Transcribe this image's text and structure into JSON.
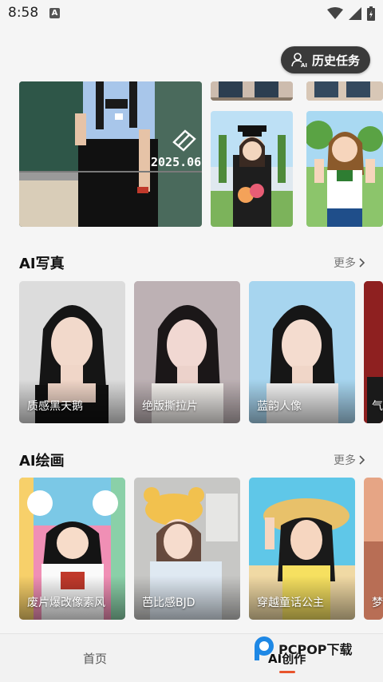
{
  "status_bar": {
    "time": "8:58",
    "notification_icon": "A"
  },
  "header": {
    "history_button_label": "历史任务"
  },
  "hero": {
    "badge_text": "2025.06"
  },
  "sections": [
    {
      "title": "AI写真",
      "more_label": "更多",
      "cards": [
        {
          "label": "质感黑天鹅"
        },
        {
          "label": "绝版撕拉片"
        },
        {
          "label": "蓝韵人像"
        },
        {
          "label": "气"
        }
      ]
    },
    {
      "title": "AI绘画",
      "more_label": "更多",
      "cards": [
        {
          "label": "废片爆改像素风"
        },
        {
          "label": "芭比感BJD"
        },
        {
          "label": "穿越童话公主"
        },
        {
          "label": "梦"
        }
      ]
    }
  ],
  "bottom_nav": {
    "tabs": [
      {
        "label": "首页"
      },
      {
        "label": "AI创作"
      }
    ]
  },
  "watermark": {
    "text": "PCPOP下载"
  },
  "colors": {
    "accent": "#e8542c",
    "dark_button": "#3a3a3a"
  }
}
